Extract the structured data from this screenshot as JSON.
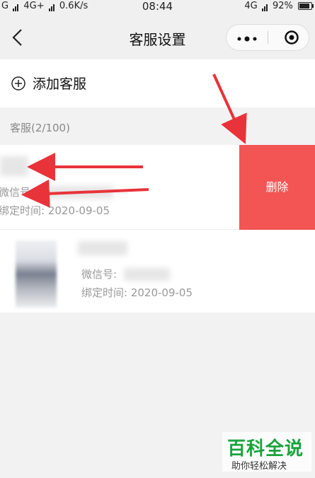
{
  "status_bar": {
    "carrier_left": "G",
    "network": "4G+",
    "speed": "0.6K/s",
    "time": "08:44",
    "network_right": "4G",
    "battery": "92%"
  },
  "nav": {
    "title": "客服设置",
    "back_icon": "chevron-left-icon",
    "more_icon": "more-dots-icon",
    "target_icon": "target-circle-icon"
  },
  "add_service": {
    "label": "添加客服",
    "icon": "plus-circle-icon"
  },
  "section": {
    "header": "客服(2/100)"
  },
  "agents": [
    {
      "wechat_label": "微信号:",
      "bind_time": "绑定时间: 2020-09-05",
      "swiped": true
    },
    {
      "wechat_label": "微信号:",
      "bind_time": "绑定时间: 2020-09-05",
      "swiped": false
    }
  ],
  "delete_label": "删除",
  "watermark": {
    "title": "百科全说",
    "subtitle": "助你轻松解决"
  },
  "colors": {
    "delete": "#f35454",
    "arrow": "#e8333a",
    "watermark_green": "#1aa33c"
  }
}
